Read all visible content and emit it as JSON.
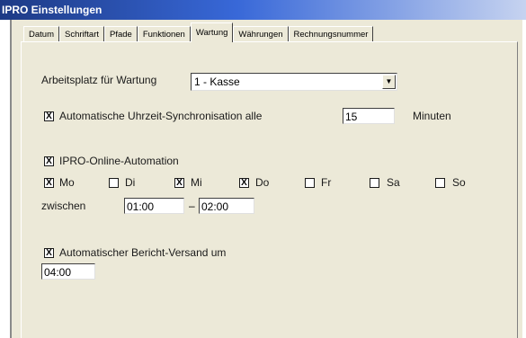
{
  "window": {
    "title": "IPRO Einstellungen"
  },
  "tabs": [
    {
      "label": "Datum"
    },
    {
      "label": "Schriftart"
    },
    {
      "label": "Pfade"
    },
    {
      "label": "Funktionen"
    },
    {
      "label": "Wartung"
    },
    {
      "label": "Währungen"
    },
    {
      "label": "Rechnungsnummer"
    }
  ],
  "active_tab": "Wartung",
  "wartung": {
    "arbeitsplatz_label": "Arbeitsplatz für Wartung",
    "arbeitsplatz_value": "1 - Kasse",
    "sync_label": "Automatische Uhrzeit-Synchronisation alle",
    "sync_checked": "X",
    "sync_minutes": "15",
    "minuten_label": "Minuten",
    "online_label": "IPRO-Online-Automation",
    "online_checked": "X",
    "days": [
      {
        "label": "Mo",
        "mark": "X"
      },
      {
        "label": "Di",
        "mark": ""
      },
      {
        "label": "Mi",
        "mark": "X"
      },
      {
        "label": "Do",
        "mark": "X"
      },
      {
        "label": "Fr",
        "mark": ""
      },
      {
        "label": "Sa",
        "mark": ""
      },
      {
        "label": "So",
        "mark": ""
      }
    ],
    "zwischen_label": "zwischen",
    "from_time": "01:00",
    "dash": "–",
    "to_time": "02:00",
    "bericht_label": "Automatischer Bericht-Versand um",
    "bericht_checked": "X",
    "bericht_time": "04:00"
  },
  "colors": {
    "title_start": "#1d3a85",
    "panel": "#ece9d8"
  }
}
